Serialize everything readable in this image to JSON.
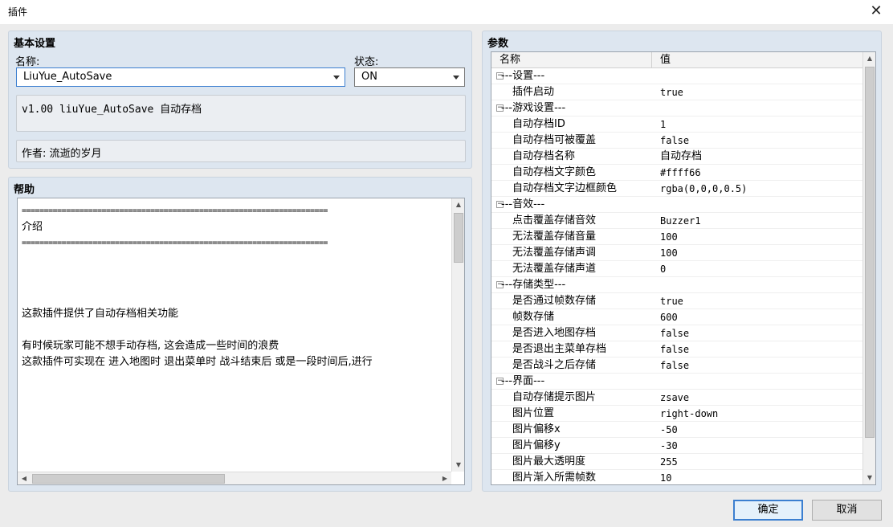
{
  "window": {
    "title": "插件"
  },
  "basic": {
    "group_title": "基本设置",
    "name_label": "名称:",
    "name_value": "LiuYue_AutoSave",
    "status_label": "状态:",
    "status_value": "ON",
    "description": "v1.00 liuYue_AutoSave 自动存档",
    "author": "作者: 流逝的岁月"
  },
  "help": {
    "group_title": "帮助",
    "lines": [
      "=====================================================================",
      "介绍",
      "=====================================================================",
      "",
      "",
      "",
      "这款插件提供了自动存档相关功能",
      "",
      "有时候玩家可能不想手动存档, 这会造成一些时间的浪费",
      "这款插件可实现在 进入地图时 退出菜单时 战斗结束后 或是一段时间后,进行"
    ]
  },
  "params": {
    "group_title": "参数",
    "col_name": "名称",
    "col_value": "值",
    "rows": [
      {
        "kind": "group",
        "name": "---设置---",
        "value": ""
      },
      {
        "kind": "item",
        "name": "插件启动",
        "value": "true"
      },
      {
        "kind": "group",
        "name": "---游戏设置---",
        "value": ""
      },
      {
        "kind": "item",
        "name": "自动存档ID",
        "value": "1"
      },
      {
        "kind": "item",
        "name": "自动存档可被覆盖",
        "value": "false"
      },
      {
        "kind": "item",
        "name": "自动存档名称",
        "value": "自动存档"
      },
      {
        "kind": "item",
        "name": "自动存档文字颜色",
        "value": "#ffff66"
      },
      {
        "kind": "item",
        "name": "自动存档文字边框颜色",
        "value": "rgba(0,0,0,0.5)"
      },
      {
        "kind": "group",
        "name": "---音效---",
        "value": ""
      },
      {
        "kind": "item",
        "name": "点击覆盖存储音效",
        "value": "Buzzer1"
      },
      {
        "kind": "item",
        "name": "无法覆盖存储音量",
        "value": "100"
      },
      {
        "kind": "item",
        "name": "无法覆盖存储声调",
        "value": "100"
      },
      {
        "kind": "item",
        "name": "无法覆盖存储声道",
        "value": "0"
      },
      {
        "kind": "group",
        "name": "---存储类型---",
        "value": ""
      },
      {
        "kind": "item",
        "name": "是否通过帧数存储",
        "value": "true"
      },
      {
        "kind": "item",
        "name": "帧数存储",
        "value": "600"
      },
      {
        "kind": "item",
        "name": "是否进入地图存档",
        "value": "false"
      },
      {
        "kind": "item",
        "name": "是否退出主菜单存档",
        "value": "false"
      },
      {
        "kind": "item",
        "name": "是否战斗之后存储",
        "value": "false"
      },
      {
        "kind": "group",
        "name": "---界面---",
        "value": ""
      },
      {
        "kind": "item",
        "name": "自动存储提示图片",
        "value": "zsave"
      },
      {
        "kind": "item",
        "name": "图片位置",
        "value": "right-down"
      },
      {
        "kind": "item",
        "name": "图片偏移x",
        "value": "-50"
      },
      {
        "kind": "item",
        "name": "图片偏移y",
        "value": "-30"
      },
      {
        "kind": "item",
        "name": "图片最大透明度",
        "value": "255"
      },
      {
        "kind": "item",
        "name": "图片渐入所需帧数",
        "value": "10"
      }
    ]
  },
  "buttons": {
    "ok": "确定",
    "cancel": "取消"
  },
  "icons": {
    "close": "close-icon",
    "expand": "collapse-toggle-icon"
  }
}
